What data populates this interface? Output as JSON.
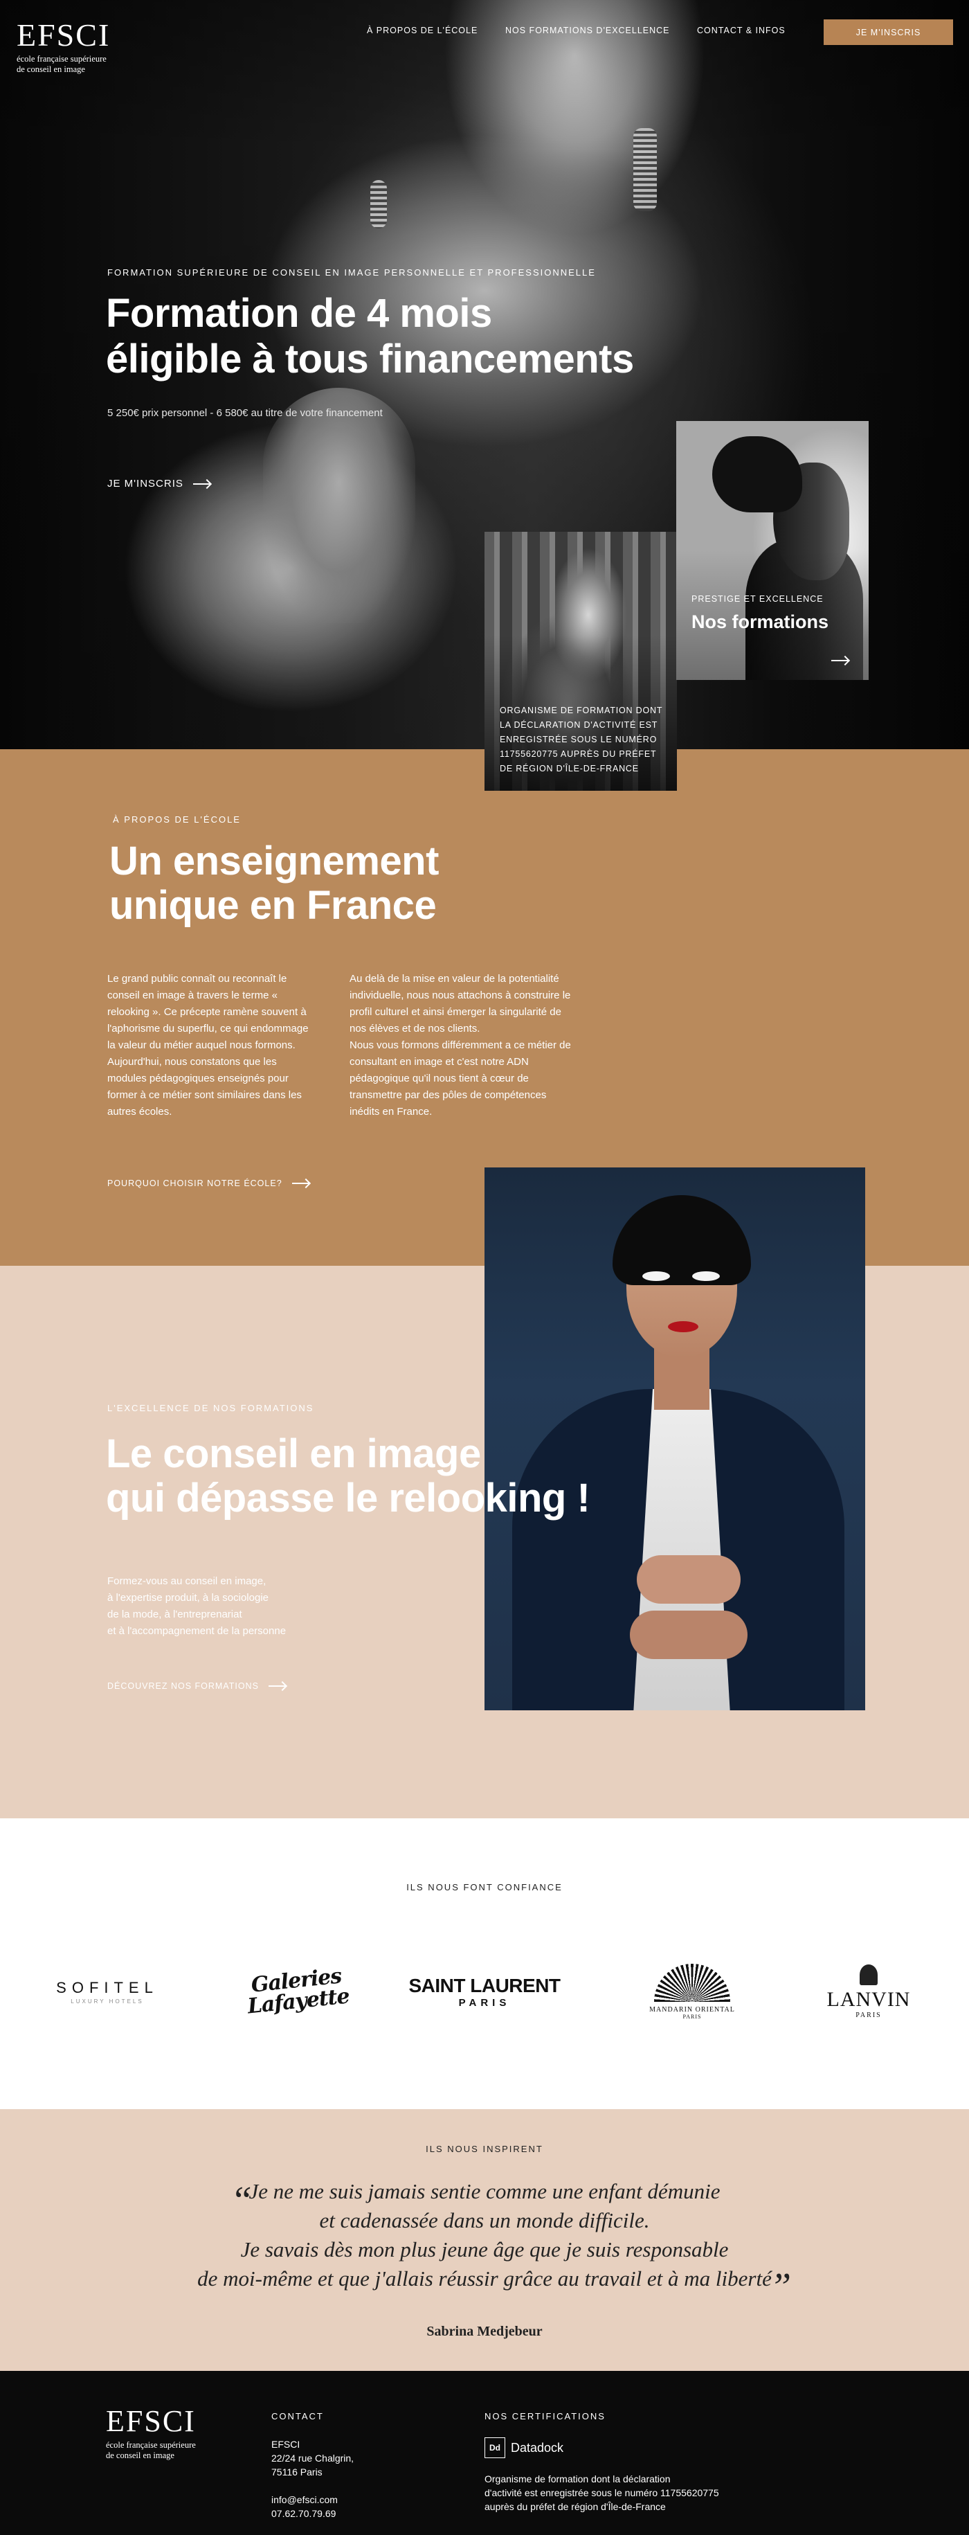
{
  "nav": {
    "logo_word": "EFSCI",
    "logo_sub_1": "école française supérieure",
    "logo_sub_2": "de conseil en image",
    "links": [
      "À PROPOS DE L'ÉCOLE",
      "NOS FORMATIONS D'EXCELLENCE",
      "CONTACT & INFOS"
    ],
    "cta": "JE M'INSCRIS"
  },
  "hero": {
    "eyebrow": "FORMATION SUPÉRIEURE DE CONSEIL EN IMAGE PERSONNELLE ET PROFESSIONNELLE",
    "title_line1": "Formation de 4 mois",
    "title_line2": "éligible à tous financements",
    "price": "5 250€ prix personnel - 6 580€ au titre de votre financement",
    "cta": "JE M'INSCRIS",
    "statue_card_text": "ORGANISME DE FORMATION DONT LA DÉCLARATION D'ACTIVITÉ EST ENREGISTRÉE SOUS LE NUMÉRO 11755620775 AUPRÈS DU PRÉFET DE RÉGION D'ÎLE-DE-FRANCE",
    "portrait_card_eyebrow": "PRESTIGE ET EXCELLENCE",
    "portrait_card_title": "Nos formations"
  },
  "about": {
    "eyebrow": "À PROPOS DE L'ÉCOLE",
    "title_line1": "Un enseignement",
    "title_line2": "unique en France",
    "col1": "Le grand public connaît ou reconnaît le conseil en image à travers le terme « relooking ». Ce précepte ramène souvent à l'aphorisme du superflu, ce qui endommage la valeur du métier auquel nous formons. Aujourd'hui, nous constatons que les modules pédagogiques enseignés pour former à ce métier sont similaires dans les autres écoles.",
    "col2_p1": "Au delà de la mise en valeur de la potentialité individuelle, nous nous attachons à construire le profil culturel et ainsi émerger la singularité de nos élèves et de nos clients.",
    "col2_p2": "Nous vous formons différemment a ce métier de consultant en image et c'est notre ADN pédagogique qu'il nous tient à cœur de transmettre par des pôles de compétences inédits en France.",
    "cta": "POURQUOI CHOISIR NOTRE ÉCOLE?"
  },
  "excellence": {
    "eyebrow": "L'EXCELLENCE DE NOS FORMATIONS",
    "title_line1": "Le conseil en image",
    "title_line2": "qui dépasse le relooking !",
    "text_line1": "Formez-vous au conseil en image,",
    "text_line2": "à l'expertise produit, à la sociologie",
    "text_line3": "de la mode, à l'entreprenariat",
    "text_line4": "et à l'accompagnement de la personne",
    "cta": "DÉCOUVREZ NOS FORMATIONS"
  },
  "trust": {
    "eyebrow": "ILS NOUS FONT CONFIANCE",
    "logos": [
      {
        "main": "SOFITEL",
        "sub": "LUXURY HOTELS"
      },
      {
        "main_1": "Galeries",
        "main_2": "Lafayette"
      },
      {
        "main": "SAINT LAURENT",
        "sub": "PARIS"
      },
      {
        "main": "MANDARIN ORIENTAL",
        "sub": "PARIS"
      },
      {
        "main": "LANVIN",
        "sub": "PARIS"
      }
    ]
  },
  "inspire": {
    "eyebrow": "ILS NOUS INSPIRENT",
    "open_quote": "“",
    "close_quote": "”",
    "line1": "Je ne me suis jamais sentie comme une enfant démunie",
    "line2": "et cadenassée dans un monde difficile.",
    "line3": "Je savais dès mon plus jeune âge que je suis responsable",
    "line4": "de moi-même et que j'allais réussir grâce au travail et à ma liberté",
    "author": "Sabrina Medjebeur"
  },
  "footer": {
    "logo_word": "EFSCI",
    "logo_sub_1": "école française supérieure",
    "logo_sub_2": "de conseil en image",
    "contact_head": "CONTACT",
    "contact_name": "EFSCI",
    "contact_addr1": "22/24 rue Chalgrin,",
    "contact_addr2": "75116 Paris",
    "contact_email": "info@efsci.com",
    "contact_phone": "07.62.70.79.69",
    "cert_head": "NOS CERTIFICATIONS",
    "badge_box": "Dd",
    "badge_name": "Datadock",
    "cert_text_1": "Organisme de formation dont la déclaration",
    "cert_text_2": "d'activité est enregistrée sous le numéro 11755620775",
    "cert_text_3": "auprès du préfet de région d'Île-de-France"
  },
  "colors": {
    "accent": "#b78454",
    "about_bg": "#b98a5c",
    "sand_bg": "#e7d0bf",
    "footer_bg": "#0b0b0b"
  },
  "icons": [
    "arrow-right-icon",
    "datadock-icon"
  ]
}
